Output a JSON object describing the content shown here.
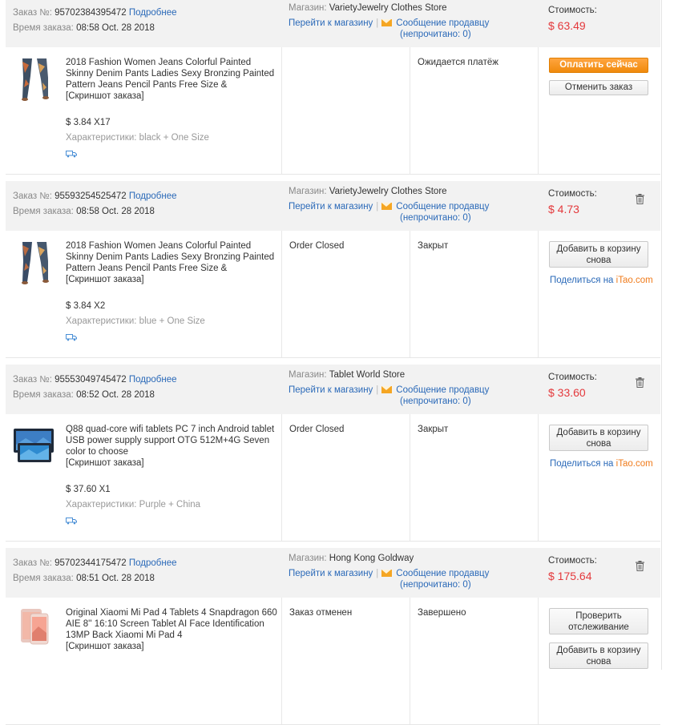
{
  "labels": {
    "order_no": "Заказ №:",
    "order_time": "Время заказа:",
    "details": "Подробнее",
    "store": "Магазин:",
    "go_to_store": "Перейти к магазину",
    "message_seller": "Сообщение продавцу",
    "unread": "(непрочитано: 0)",
    "cost": "Стоимость:",
    "screenshot": "[Скриншот заказа]",
    "characteristics": "Характеристики:",
    "share_prefix": "Поделиться на",
    "share_site": "iTao.com"
  },
  "orders": [
    {
      "order_no": "95702384395472",
      "time": "08:58 Oct. 28 2018",
      "store_name": "VarietyJewelry Clothes Store",
      "cost": "$ 63.49",
      "product_title": "2018 Fashion Women Jeans Colorful Painted Skinny Denim Pants Ladies Sexy Bronzing Painted Pattern Jeans Pencil Pants Free Size &",
      "price_qty": "$ 3.84 X17",
      "characteristics": "black + One Size",
      "status1": "",
      "status2": "Ожидается платёж",
      "btn1": "Оплатить сейчас",
      "btn2": "Отменить заказ"
    },
    {
      "order_no": "95593254525472",
      "time": "08:58 Oct. 28 2018",
      "store_name": "VarietyJewelry Clothes Store",
      "cost": "$ 4.73",
      "product_title": "2018 Fashion Women Jeans Colorful Painted Skinny Denim Pants Ladies Sexy Bronzing Painted Pattern Jeans Pencil Pants Free Size &",
      "price_qty": "$ 3.84 X2",
      "characteristics": "blue + One Size",
      "status1": "Order Closed",
      "status2": "Закрыт",
      "btn1": "Добавить в корзину снова"
    },
    {
      "order_no": "95553049745472",
      "time": "08:52 Oct. 28 2018",
      "store_name": "Tablet World Store",
      "cost": "$ 33.60",
      "product_title": "Q88 quad-core wifi tablets PC 7 inch Android tablet USB power supply support OTG 512M+4G Seven color to choose",
      "price_qty": "$ 37.60 X1",
      "characteristics": "Purple + China",
      "status1": "Order Closed",
      "status2": "Закрыт",
      "btn1": "Добавить в корзину снова"
    },
    {
      "order_no": "95702344175472",
      "time": "08:51 Oct. 28 2018",
      "store_name": "Hong Kong Goldway",
      "cost": "$ 175.64",
      "product_title": "Original Xiaomi Mi Pad 4 Tablets 4 Snapdragon 660 AIE 8'' 16:10 Screen Tablet AI Face Identification 13MP Back Xiaomi Mi Pad 4",
      "status1": "Заказ отменен",
      "status2": "Завершено",
      "btn1": "Проверить отслеживание",
      "btn2": "Добавить в корзину снова"
    }
  ],
  "colors": {
    "link": "#2a69b8",
    "price": "#e4393c",
    "pay_button": "#f39018",
    "header_bg": "#f2f2f2",
    "itao": "#f07b1b"
  },
  "icons": [
    "mail-icon",
    "trash-icon",
    "truck-icon"
  ]
}
